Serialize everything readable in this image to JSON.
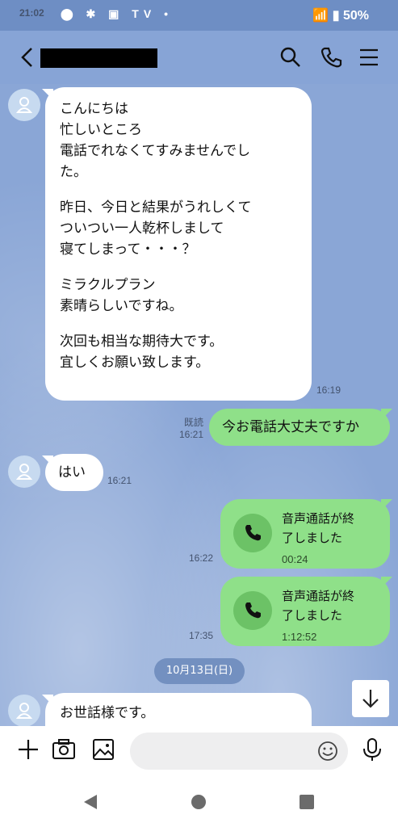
{
  "status_bar": {
    "time": "21:02",
    "icons": "⬤ ✱ ▣ TV •",
    "battery": "50%"
  },
  "header": {
    "back_icon": "back-chevron-icon",
    "search_icon": "search-icon",
    "call_icon": "phone-icon",
    "menu_icon": "menu-icon"
  },
  "messages": [
    {
      "type": "incoming",
      "paragraphs": [
        "こんにちは\n忙しいところ\n電話でれなくてすみませんでし\nた。",
        "昨日、今日と結果がうれしくて\nついつい一人乾杯しまして\n寝てしまって・・・？",
        "ミラクルプラン\n素晴らしいですね。",
        "次回も相当な期待大です。\n宜しくお願い致します。"
      ],
      "time": "16:19"
    },
    {
      "type": "outgoing",
      "text": "今お電話大丈夫ですか",
      "read": "既読",
      "time": "16:21"
    },
    {
      "type": "incoming",
      "text": "はい",
      "time": "16:21"
    },
    {
      "type": "call",
      "title": "音声通話が終\n了しました",
      "duration": "00:24",
      "time": "16:22"
    },
    {
      "type": "call",
      "title": "音声通話が終\n了しました",
      "duration": "1:12:52",
      "time": "17:35"
    },
    {
      "type": "incoming",
      "text": "お世話様です。"
    }
  ],
  "date_separator": "10月13日(日)",
  "input_bar": {
    "placeholder": ""
  },
  "colors": {
    "outgoing": "#8fe089",
    "incoming": "#ffffff",
    "background": "#8aa6d6"
  }
}
